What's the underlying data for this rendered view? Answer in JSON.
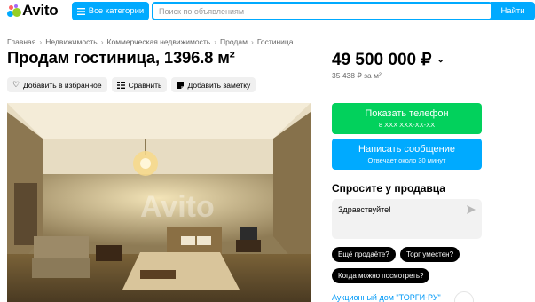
{
  "header": {
    "logo_text": "Avito",
    "categories_label": "Все категории",
    "search_placeholder": "Поиск по объявлениям",
    "find_label": "Найти"
  },
  "breadcrumb": [
    "Главная",
    "Недвижимость",
    "Коммерческая недвижимость",
    "Продам",
    "Гостиница"
  ],
  "listing": {
    "title": "Продам гостиница, 1396.8 м²",
    "actions": {
      "favorite": "Добавить в избранное",
      "compare": "Сравнить",
      "note": "Добавить заметку"
    },
    "price": "49 500 000 ₽",
    "price_per_sqm": "35 438 ₽ за м²"
  },
  "contact": {
    "phone_label": "Показать телефон",
    "phone_masked": "8 XXX XXX-XX-XX",
    "message_label": "Написать сообщение",
    "message_sub": "Отвечает около 30 минут"
  },
  "ask": {
    "title": "Спросите у продавца",
    "message_value": "Здравствуйте!",
    "chips": [
      "Ещё продаёте?",
      "Торг уместен?",
      "Когда можно посмотреть?"
    ]
  },
  "seller": {
    "name": "Аукционный дом \"ТОРГИ-РУ\""
  },
  "photo": {
    "watermark": "Avito"
  },
  "colors": {
    "brand_blue": "#00aaff",
    "phone_green": "#02d15c"
  }
}
